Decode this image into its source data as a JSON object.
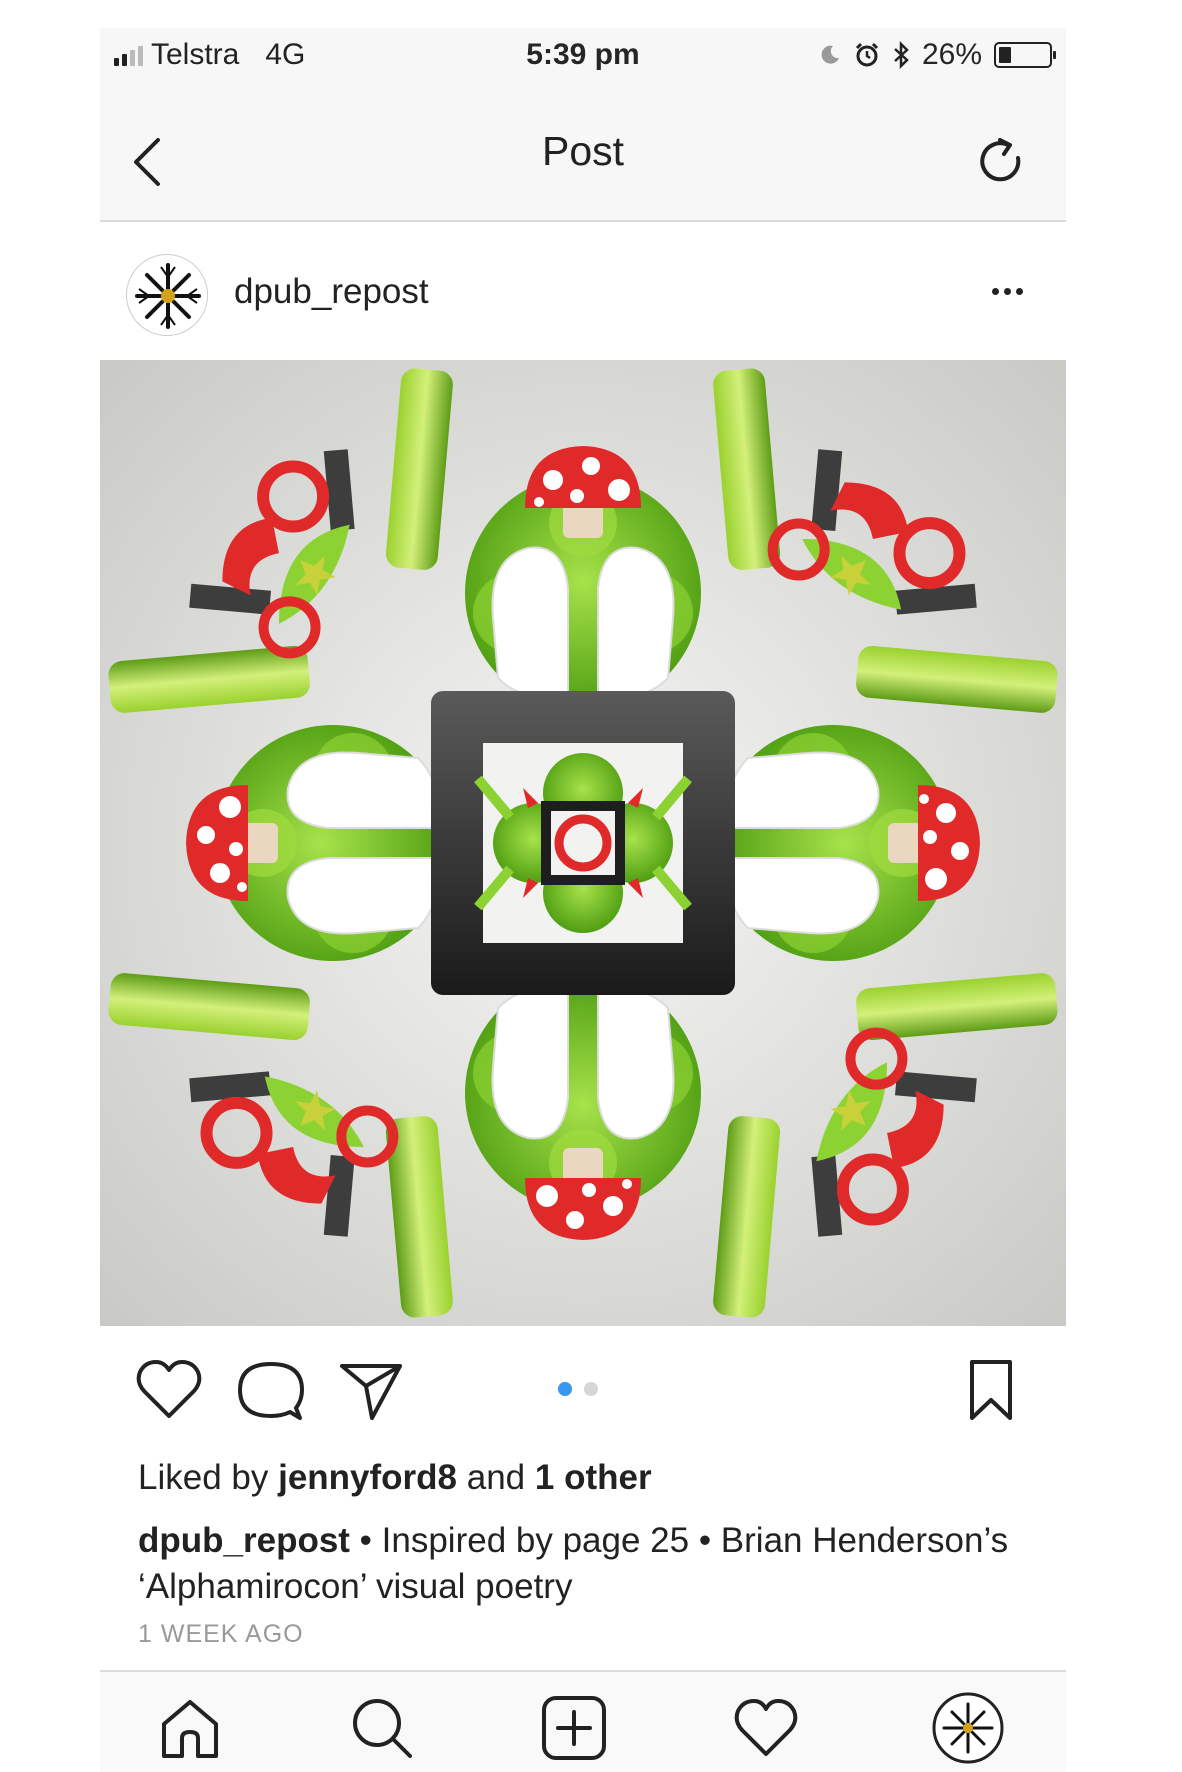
{
  "status_bar": {
    "carrier": "Telstra",
    "network": "4G",
    "time": "5:39 pm",
    "battery_percent": "26%",
    "battery_level": 0.26,
    "icons": [
      "signal-icon",
      "moon-icon",
      "alarm-icon",
      "bluetooth-icon",
      "battery-icon"
    ]
  },
  "header": {
    "title": "Post",
    "back_icon": "chevron-left-icon",
    "refresh_icon": "refresh-icon"
  },
  "post": {
    "username": "dpub_repost",
    "more_icon": "ellipsis-icon",
    "image_icon": "kaleidoscope-image",
    "carousel": {
      "count": 2,
      "active_index": 0
    }
  },
  "actions": {
    "icons": [
      "heart-icon",
      "comment-icon",
      "share-icon",
      "bookmark-icon"
    ]
  },
  "likes": {
    "prefix": "Liked by ",
    "user": "jennyford8",
    "middle": " and ",
    "others": "1 other"
  },
  "caption": {
    "username": "dpub_repost",
    "text": " • Inspired by page 25 • Brian Henderson’s ‘Alphamirocon’ visual poetry"
  },
  "timestamp": "1 WEEK AGO",
  "tab_bar": {
    "items": [
      "home-icon",
      "search-icon",
      "add-icon",
      "activity-icon",
      "profile-icon"
    ]
  },
  "colors": {
    "accent_blue": "#3897f0",
    "notification_red": "#ed4956",
    "mushroom_red": "#e02a2a",
    "leaf_green": "#7cc225"
  }
}
